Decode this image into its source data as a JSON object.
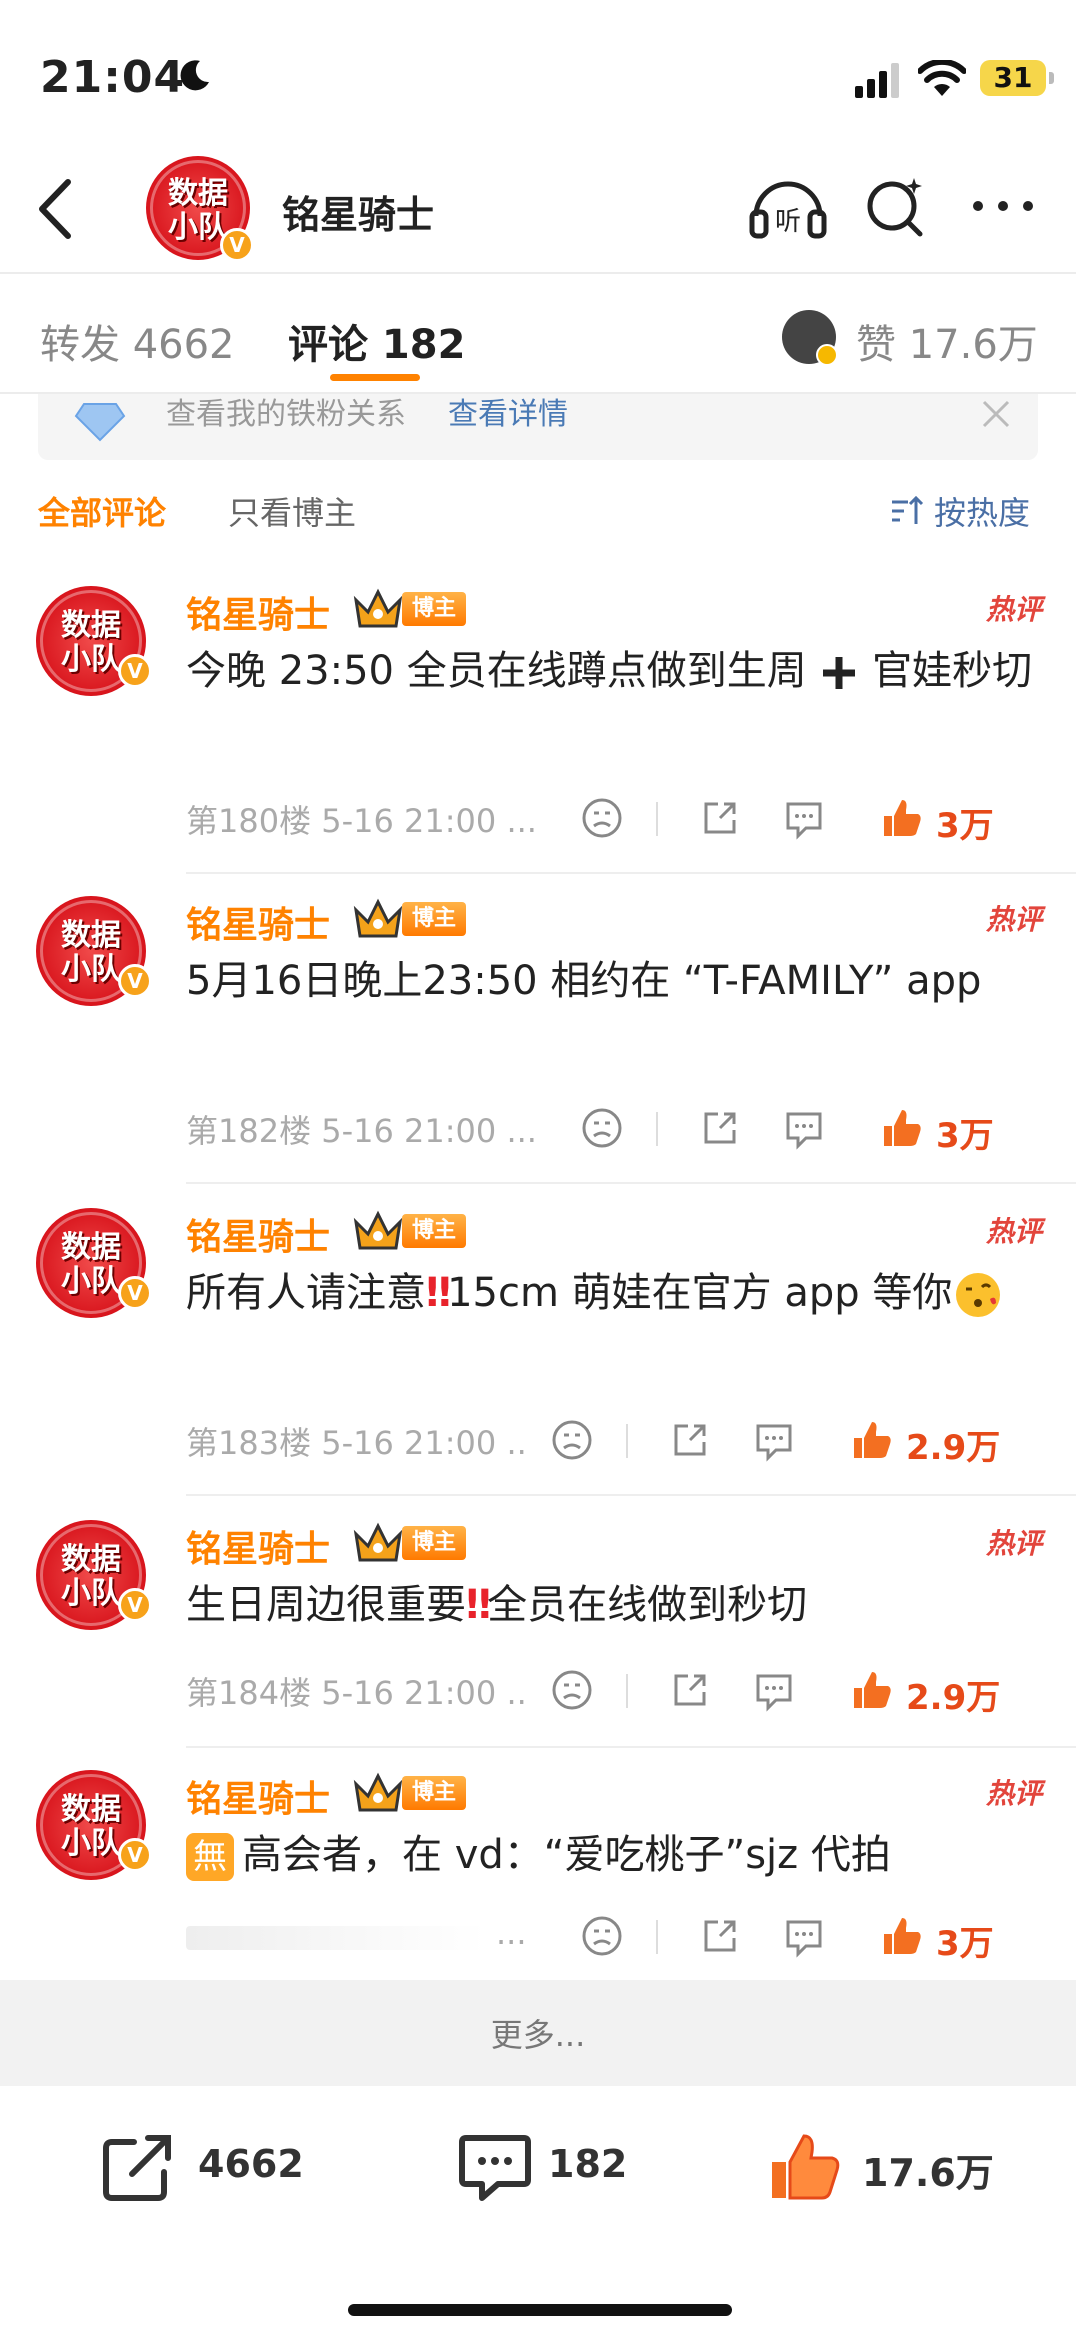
{
  "status": {
    "time": "21:04",
    "battery": "31"
  },
  "header": {
    "name": "铭星骑士",
    "avatar_line1": "数据",
    "avatar_line2": "小队",
    "verified": "V"
  },
  "tabs": {
    "repost": "转发 4662",
    "comments": "评论 182",
    "likes": "赞 17.6万"
  },
  "banner": {
    "text": "查看我的铁粉关系",
    "link": "查看详情"
  },
  "filters": {
    "all": "全部评论",
    "blogger_only": "只看博主",
    "sort": "按热度"
  },
  "comments": [
    {
      "name": "铭星骑士",
      "badge": "博主",
      "hot": "热评",
      "text_a": "今晚 23:50 全员在线蹲点做到生周 ",
      "text_b": " 官娃秒切",
      "meta": "第180楼 5-16 21:00 ...",
      "likes": "3万"
    },
    {
      "name": "铭星骑士",
      "badge": "博主",
      "hot": "热评",
      "text": "5月16日晚上23:50 相约在 “T-FAMILY” app",
      "meta": "第182楼 5-16 21:00 ...",
      "likes": "3万"
    },
    {
      "name": "铭星骑士",
      "badge": "博主",
      "hot": "热评",
      "text_a": "所有人请注意",
      "bang": "‼",
      "text_b": "15cm 萌娃在官方 app 等你",
      "meta": "第183楼 5-16 21:00 ..",
      "likes": "2.9万"
    },
    {
      "name": "铭星骑士",
      "badge": "博主",
      "hot": "热评",
      "text_a": "生日周边很重要",
      "bang": "‼",
      "text_b": "全员在线做到秒切",
      "meta": "第184楼 5-16 21:00 ..",
      "likes": "2.9万"
    },
    {
      "name": "铭星骑士",
      "badge": "博主",
      "hot": "热评",
      "free_glyph": "無",
      "text": "高会者，在 vd：“爱吃桃子”sjz 代拍",
      "meta": "...",
      "likes": "3万"
    }
  ],
  "more": "更多...",
  "bottom": {
    "reposts": "4662",
    "comments": "182",
    "likes": "17.6万"
  },
  "colors": {
    "accent": "#ff8200",
    "like": "#e64a19",
    "link": "#4a6fa5",
    "avatar_red": "#d8141c"
  }
}
